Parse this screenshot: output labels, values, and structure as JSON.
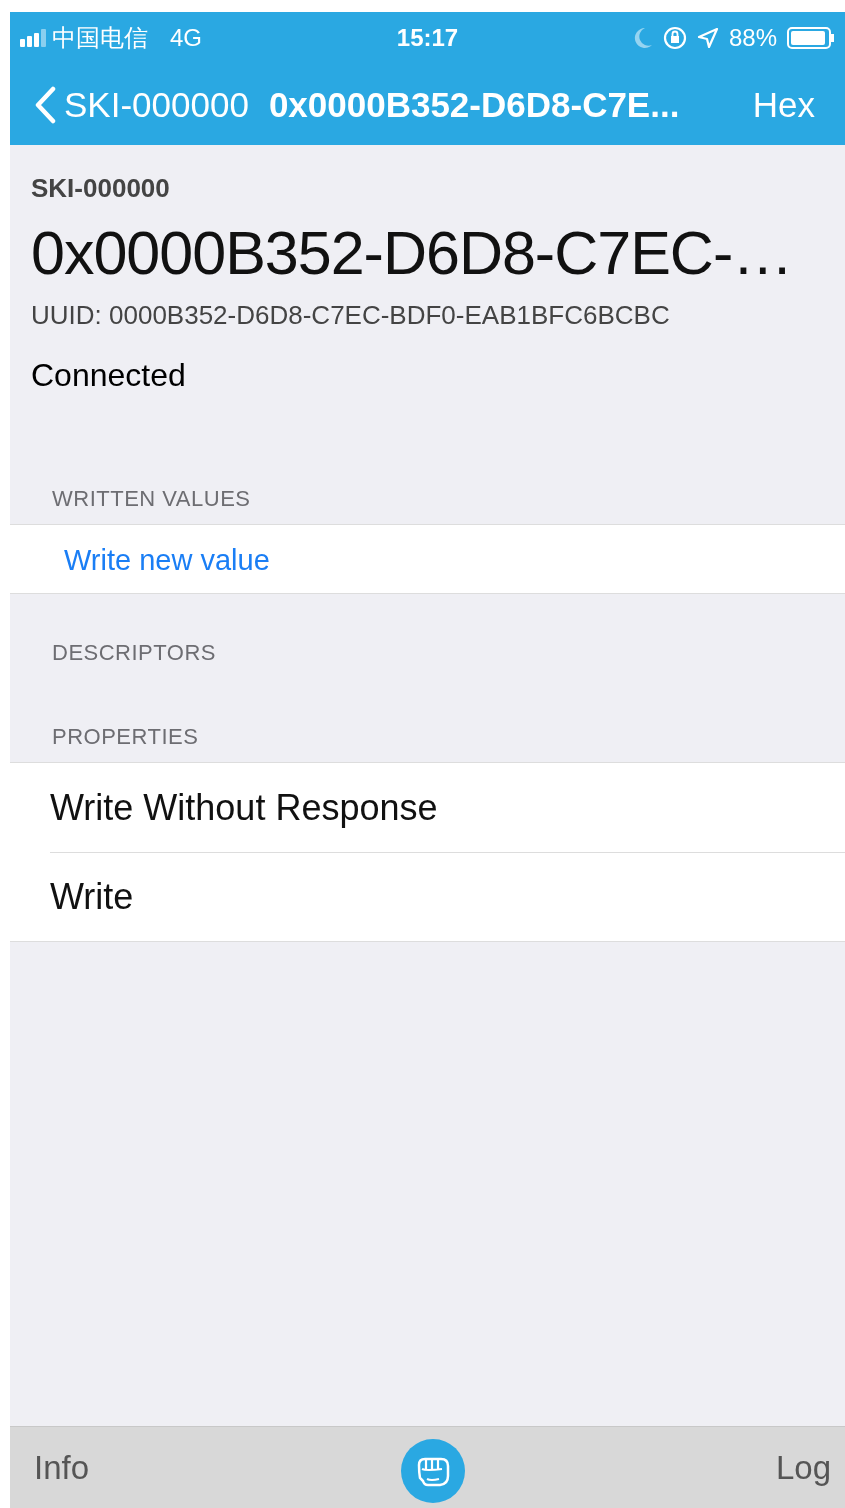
{
  "status_bar": {
    "carrier": "中国电信",
    "network": "4G",
    "time": "15:17",
    "battery": "88%"
  },
  "nav_bar": {
    "back": "SKI-000000",
    "title": "0x0000B352-D6D8-C7E...",
    "action": "Hex"
  },
  "header": {
    "peripheral": "SKI-000000",
    "characteristic": "0x0000B352-D6D8-C7EC-…",
    "uuid": "UUID: 0000B352-D6D8-C7EC-BDF0-EAB1BFC6BCBC",
    "status": "Connected"
  },
  "sections": [
    {
      "title": "WRITTEN VALUES",
      "rows": [
        {
          "kind": "action",
          "label": "Write new value"
        }
      ]
    },
    {
      "title": "DESCRIPTORS"
    },
    {
      "title": "PROPERTIES",
      "rows": [
        {
          "kind": "plain",
          "label": "Write Without Response"
        },
        {
          "kind": "plain",
          "label": "Write"
        }
      ]
    }
  ],
  "tab_bar": {
    "left": "Info",
    "right": "Log"
  }
}
